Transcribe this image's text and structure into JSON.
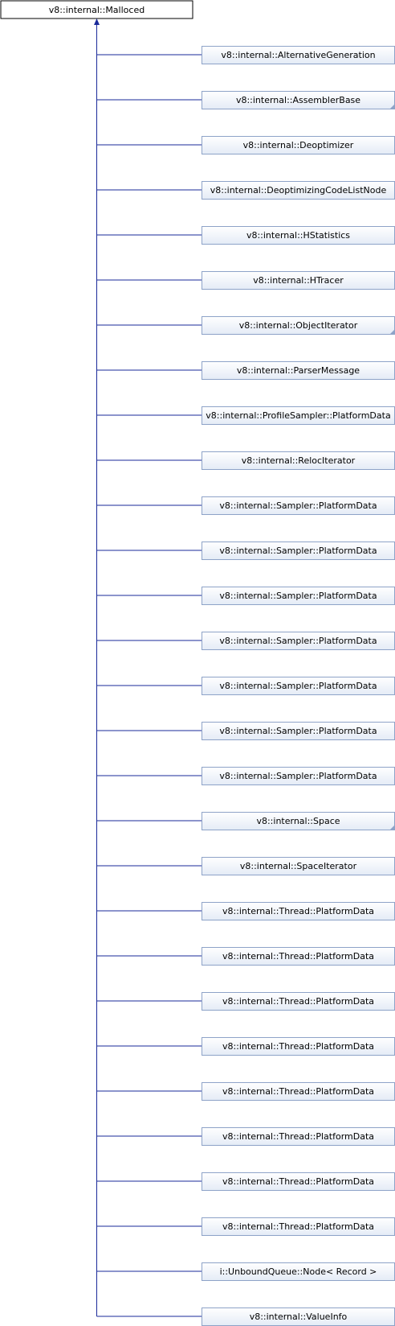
{
  "root": {
    "label": "v8::internal::Malloced"
  },
  "children": [
    {
      "label": "v8::internal::AlternativeGeneration",
      "has_more": false
    },
    {
      "label": "v8::internal::AssemblerBase",
      "has_more": true
    },
    {
      "label": "v8::internal::Deoptimizer",
      "has_more": false
    },
    {
      "label": "v8::internal::DeoptimizingCodeListNode",
      "has_more": false
    },
    {
      "label": "v8::internal::HStatistics",
      "has_more": false
    },
    {
      "label": "v8::internal::HTracer",
      "has_more": false
    },
    {
      "label": "v8::internal::ObjectIterator",
      "has_more": true
    },
    {
      "label": "v8::internal::ParserMessage",
      "has_more": false
    },
    {
      "label": "v8::internal::ProfileSampler::PlatformData",
      "has_more": false
    },
    {
      "label": "v8::internal::RelocIterator",
      "has_more": false
    },
    {
      "label": "v8::internal::Sampler::PlatformData",
      "has_more": false
    },
    {
      "label": "v8::internal::Sampler::PlatformData",
      "has_more": false
    },
    {
      "label": "v8::internal::Sampler::PlatformData",
      "has_more": false
    },
    {
      "label": "v8::internal::Sampler::PlatformData",
      "has_more": false
    },
    {
      "label": "v8::internal::Sampler::PlatformData",
      "has_more": false
    },
    {
      "label": "v8::internal::Sampler::PlatformData",
      "has_more": false
    },
    {
      "label": "v8::internal::Sampler::PlatformData",
      "has_more": false
    },
    {
      "label": "v8::internal::Space",
      "has_more": true
    },
    {
      "label": "v8::internal::SpaceIterator",
      "has_more": false
    },
    {
      "label": "v8::internal::Thread::PlatformData",
      "has_more": false
    },
    {
      "label": "v8::internal::Thread::PlatformData",
      "has_more": false
    },
    {
      "label": "v8::internal::Thread::PlatformData",
      "has_more": false
    },
    {
      "label": "v8::internal::Thread::PlatformData",
      "has_more": false
    },
    {
      "label": "v8::internal::Thread::PlatformData",
      "has_more": false
    },
    {
      "label": "v8::internal::Thread::PlatformData",
      "has_more": false
    },
    {
      "label": "v8::internal::Thread::PlatformData",
      "has_more": false
    },
    {
      "label": "v8::internal::Thread::PlatformData",
      "has_more": false
    },
    {
      "label": "i::UnboundQueue::Node< Record >",
      "has_more": false
    },
    {
      "label": "v8::internal::ValueInfo",
      "has_more": false
    }
  ],
  "colors": {
    "edge": "#1a2a9a",
    "node_border": "#8ea3c8",
    "node_fill_top": "#ffffff",
    "node_fill_bottom": "#e4ebf6",
    "root_border": "#000000",
    "text": "#000000",
    "more_marker": "#8ea3c8"
  }
}
